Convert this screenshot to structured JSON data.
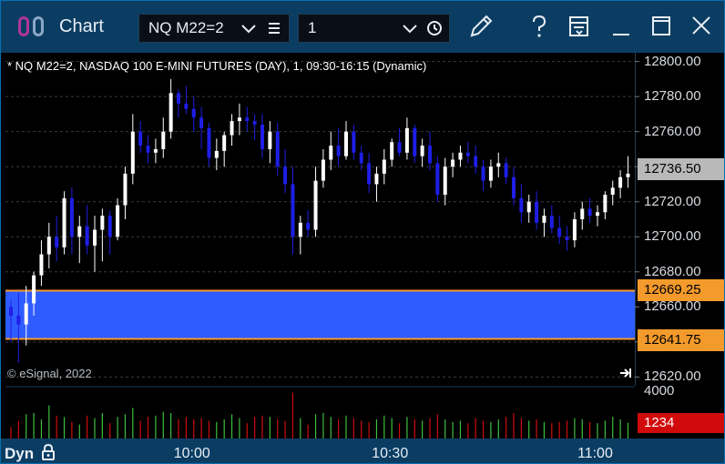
{
  "window": {
    "title": "Chart",
    "icon": "chart-window-icon",
    "symbol_value": "NQ M22=2",
    "interval_value": "1",
    "header_icons": [
      "symbol-dropdown-icon",
      "list-icon",
      "interval-dropdown-icon",
      "clock-icon",
      "pencil-icon",
      "help-icon",
      "layout-icon",
      "minimize-icon",
      "maximize-icon",
      "close-icon"
    ]
  },
  "chart": {
    "description": "* NQ M22=2, NASDAQ 100 E-MINI FUTURES (DAY), 1, 09:30-16:15 (Dynamic)",
    "watermark": "© eSignal, 2022",
    "price_labels": [
      "12800.00",
      "12780.00",
      "12760.00",
      "12736.50",
      "12720.00",
      "12700.00",
      "12680.00",
      "12669.25",
      "12660.00",
      "12641.75",
      "12620.00"
    ],
    "last_price": "12736.50",
    "band_upper": "12669.25",
    "band_lower": "12641.75",
    "volume_axis_label": "4000",
    "volume_last": "1234",
    "time_labels": [
      "10:00",
      "10:30",
      "11:00"
    ],
    "mode_label": "Dyn",
    "colors": {
      "up": "#ffffff",
      "down": "#1e1ee6",
      "band": "#2f5cff",
      "band_border": "#f39a2c",
      "vol_up": "#3fbf3f",
      "vol_down": "#d10b0b"
    }
  },
  "chart_data": {
    "type": "candlestick",
    "ylim": [
      12615,
      12805
    ],
    "ohlc": [
      [
        12660,
        12664,
        12640,
        12655
      ],
      [
        12655,
        12668,
        12628,
        12650
      ],
      [
        12650,
        12672,
        12638,
        12662
      ],
      [
        12662,
        12680,
        12655,
        12678
      ],
      [
        12678,
        12698,
        12672,
        12690
      ],
      [
        12690,
        12708,
        12682,
        12700
      ],
      [
        12700,
        12712,
        12686,
        12694
      ],
      [
        12694,
        12726,
        12690,
        12722
      ],
      [
        12722,
        12728,
        12690,
        12700
      ],
      [
        12700,
        12712,
        12685,
        12706
      ],
      [
        12706,
        12718,
        12690,
        12695
      ],
      [
        12695,
        12712,
        12680,
        12704
      ],
      [
        12704,
        12716,
        12686,
        12712
      ],
      [
        12712,
        12715,
        12690,
        12700
      ],
      [
        12700,
        12722,
        12698,
        12718
      ],
      [
        12718,
        12740,
        12710,
        12736
      ],
      [
        12736,
        12770,
        12730,
        12760
      ],
      [
        12760,
        12766,
        12748,
        12752
      ],
      [
        12752,
        12758,
        12742,
        12748
      ],
      [
        12748,
        12756,
        12742,
        12750
      ],
      [
        12750,
        12768,
        12745,
        12760
      ],
      [
        12760,
        12790,
        12756,
        12782
      ],
      [
        12782,
        12784,
        12768,
        12776
      ],
      [
        12776,
        12786,
        12770,
        12773
      ],
      [
        12773,
        12780,
        12760,
        12768
      ],
      [
        12768,
        12774,
        12750,
        12762
      ],
      [
        12762,
        12765,
        12740,
        12745
      ],
      [
        12745,
        12756,
        12738,
        12749
      ],
      [
        12749,
        12760,
        12740,
        12758
      ],
      [
        12758,
        12770,
        12752,
        12766
      ],
      [
        12766,
        12776,
        12758,
        12768
      ],
      [
        12768,
        12774,
        12760,
        12766
      ],
      [
        12766,
        12770,
        12755,
        12764
      ],
      [
        12764,
        12770,
        12745,
        12750
      ],
      [
        12750,
        12766,
        12742,
        12760
      ],
      [
        12760,
        12765,
        12735,
        12740
      ],
      [
        12740,
        12750,
        12725,
        12730
      ],
      [
        12730,
        12740,
        12690,
        12700
      ],
      [
        12700,
        12712,
        12690,
        12708
      ],
      [
        12708,
        12715,
        12700,
        12704
      ],
      [
        12704,
        12740,
        12700,
        12732
      ],
      [
        12732,
        12750,
        12728,
        12744
      ],
      [
        12744,
        12760,
        12738,
        12752
      ],
      [
        12752,
        12762,
        12740,
        12746
      ],
      [
        12746,
        12766,
        12744,
        12760
      ],
      [
        12760,
        12764,
        12744,
        12748
      ],
      [
        12748,
        12752,
        12738,
        12742
      ],
      [
        12742,
        12748,
        12725,
        12730
      ],
      [
        12730,
        12740,
        12720,
        12736
      ],
      [
        12736,
        12750,
        12730,
        12744
      ],
      [
        12744,
        12756,
        12740,
        12754
      ],
      [
        12754,
        12762,
        12746,
        12748
      ],
      [
        12748,
        12768,
        12744,
        12762
      ],
      [
        12762,
        12764,
        12742,
        12746
      ],
      [
        12746,
        12756,
        12740,
        12752
      ],
      [
        12752,
        12760,
        12738,
        12742
      ],
      [
        12742,
        12746,
        12720,
        12724
      ],
      [
        12724,
        12745,
        12718,
        12740
      ],
      [
        12740,
        12748,
        12734,
        12744
      ],
      [
        12744,
        12752,
        12740,
        12748
      ],
      [
        12748,
        12754,
        12742,
        12746
      ],
      [
        12746,
        12752,
        12736,
        12740
      ],
      [
        12740,
        12744,
        12726,
        12732
      ],
      [
        12732,
        12744,
        12728,
        12740
      ],
      [
        12740,
        12748,
        12734,
        12742
      ],
      [
        12742,
        12745,
        12730,
        12734
      ],
      [
        12734,
        12740,
        12718,
        12722
      ],
      [
        12722,
        12730,
        12708,
        12714
      ],
      [
        12714,
        12724,
        12708,
        12720
      ],
      [
        12720,
        12726,
        12704,
        12708
      ],
      [
        12708,
        12716,
        12700,
        12712
      ],
      [
        12712,
        12718,
        12702,
        12705
      ],
      [
        12705,
        12712,
        12696,
        12700
      ],
      [
        12700,
        12706,
        12692,
        12698
      ],
      [
        12698,
        12714,
        12694,
        12710
      ],
      [
        12710,
        12720,
        12704,
        12716
      ],
      [
        12716,
        12722,
        12708,
        12712
      ],
      [
        12712,
        12718,
        12706,
        12714
      ],
      [
        12714,
        12726,
        12710,
        12724
      ],
      [
        12724,
        12732,
        12718,
        12728
      ],
      [
        12728,
        12738,
        12722,
        12734
      ],
      [
        12734,
        12746,
        12728,
        12736
      ]
    ],
    "volume": [
      900,
      1400,
      1900,
      2000,
      1500,
      2600,
      1800,
      1700,
      1300,
      1100,
      1800,
      1600,
      2000,
      1200,
      1700,
      1900,
      2400,
      1400,
      1700,
      1800,
      2100,
      2000,
      1500,
      1700,
      1500,
      1600,
      1400,
      1300,
      1500,
      1900,
      1600,
      1200,
      1700,
      1800,
      1700,
      1500,
      1400,
      3600,
      1600,
      1100,
      1900,
      2000,
      1700,
      1500,
      1800,
      1600,
      1400,
      1300,
      1500,
      1800,
      1600,
      1200,
      1700,
      1500,
      1400,
      1600,
      1900,
      1500,
      1300,
      1400,
      1200,
      1600,
      1400,
      1300,
      1500,
      1700,
      2000,
      1600,
      1400,
      1500,
      1300,
      1200,
      1300,
      1400,
      1600,
      1500,
      1300,
      1200,
      1400,
      1700,
      1500,
      1234
    ],
    "volume_ylim": [
      0,
      4000
    ],
    "band": [
      12641.75,
      12669.25
    ],
    "x_ticks": [
      {
        "label": "10:00",
        "index": 24
      },
      {
        "label": "10:30",
        "index": 50
      },
      {
        "label": "11:00",
        "index": 77
      }
    ]
  }
}
